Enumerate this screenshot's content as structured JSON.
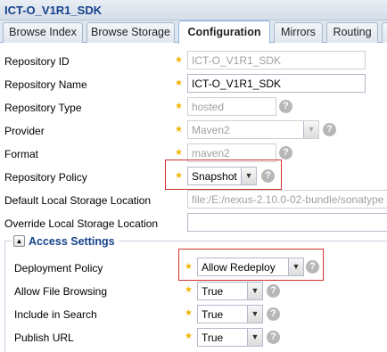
{
  "window": {
    "title": "ICT-O_V1R1_SDK"
  },
  "tabs": [
    {
      "label": "Browse Index"
    },
    {
      "label": "Browse Storage"
    },
    {
      "label": "Configuration"
    },
    {
      "label": "Mirrors"
    },
    {
      "label": "Routing"
    }
  ],
  "form": {
    "repository_id": {
      "label": "Repository ID",
      "value": "ICT-O_V1R1_SDK"
    },
    "repository_name": {
      "label": "Repository Name",
      "value": "ICT-O_V1R1_SDK"
    },
    "repository_type": {
      "label": "Repository Type",
      "value": "hosted"
    },
    "provider": {
      "label": "Provider",
      "value": "Maven2"
    },
    "format": {
      "label": "Format",
      "value": "maven2"
    },
    "repository_policy": {
      "label": "Repository Policy",
      "value": "Snapshot"
    },
    "default_storage": {
      "label": "Default Local Storage Location",
      "value": "file:/E:/nexus-2.10.0-02-bundle/sonatype"
    },
    "override_storage": {
      "label": "Override Local Storage Location",
      "value": ""
    }
  },
  "access_settings": {
    "legend": "Access Settings",
    "deployment_policy": {
      "label": "Deployment Policy",
      "value": "Allow Redeploy"
    },
    "allow_file_browsing": {
      "label": "Allow File Browsing",
      "value": "True"
    },
    "include_in_search": {
      "label": "Include in Search",
      "value": "True"
    },
    "publish_url": {
      "label": "Publish URL",
      "value": "True"
    }
  },
  "symbols": {
    "required": "★",
    "help": "?",
    "dropdown": "▼",
    "collapse": "▲"
  },
  "colors": {
    "highlight": "#d12f2f",
    "required_star": "#f0b400",
    "title": "#15428b",
    "help_icon": "#b7b7b7"
  }
}
